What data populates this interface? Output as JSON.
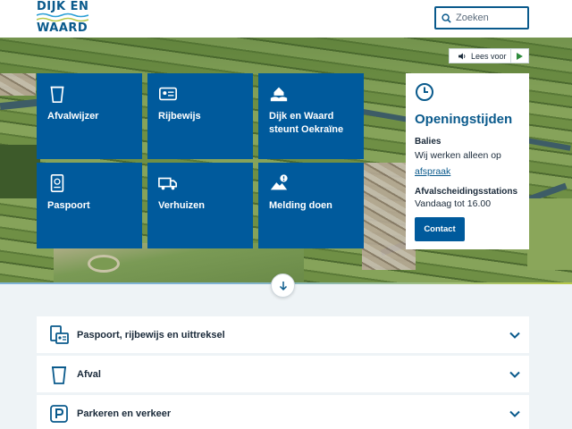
{
  "header": {
    "logo_top": "DIJK EN",
    "logo_bottom": "WAARD",
    "search_placeholder": "Zoeken",
    "icon": "search-icon"
  },
  "readspeaker": {
    "label": "Lees voor",
    "icons": [
      "speaker-icon",
      "play-icon"
    ]
  },
  "tiles": [
    {
      "label": "Afvalwijzer",
      "icon": "waste-bin-icon"
    },
    {
      "label": "Rijbewijs",
      "icon": "id-card-icon"
    },
    {
      "label": "Dijk en Waard steunt Oekraïne",
      "icon": "helping-hands-icon"
    },
    {
      "label": "Paspoort",
      "icon": "passport-icon"
    },
    {
      "label": "Verhuizen",
      "icon": "moving-truck-icon"
    },
    {
      "label": "Melding doen",
      "icon": "report-warning-icon"
    }
  ],
  "opening_hours": {
    "icon": "clock-icon",
    "title": "Openingstijden",
    "balies_label": "Balies",
    "balies_text": "Wij werken alleen op",
    "balies_link": "afspraak",
    "afval_label": "Afvalscheidingsstations",
    "afval_text": "Vandaag tot 16.00",
    "button": "Contact"
  },
  "scroll_icon": "arrow-down-icon",
  "accordion": [
    {
      "label": "Paspoort, rijbewijs en uittreksel",
      "icon": "documents-icon"
    },
    {
      "label": "Afval",
      "icon": "waste-bin-icon"
    },
    {
      "label": "Parkeren en verkeer",
      "icon": "parking-icon"
    }
  ],
  "colors": {
    "primary": "#005a9c",
    "brand_text": "#0a5a8c",
    "background": "#eef3f6",
    "accent_green": "#b8c94a"
  }
}
